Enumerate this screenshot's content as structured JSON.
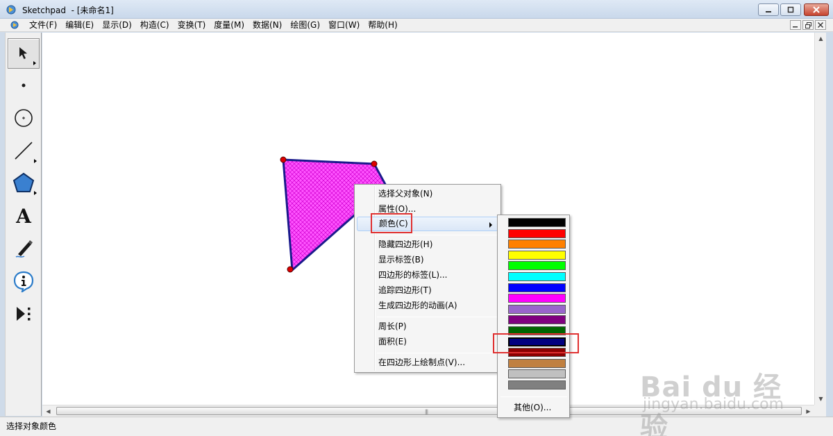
{
  "window": {
    "app_name": "Sketchpad",
    "document": "- [未命名1]"
  },
  "menubar": {
    "items": [
      "文件(F)",
      "编辑(E)",
      "显示(D)",
      "构造(C)",
      "变换(T)",
      "度量(M)",
      "数据(N)",
      "绘图(G)",
      "窗口(W)",
      "帮助(H)"
    ]
  },
  "toolbox": {
    "tools": [
      "arrow-select-tool",
      "point-tool",
      "compass-tool",
      "straightedge-tool",
      "polygon-tool",
      "text-tool",
      "marker-tool",
      "information-tool",
      "custom-tool"
    ],
    "text_tool_glyph": "A"
  },
  "context_menu": {
    "items": [
      "选择父对象(N)",
      "属性(O)...",
      "颜色(C)",
      "隐藏四边形(H)",
      "显示标签(B)",
      "四边形的标签(L)...",
      "追踪四边形(T)",
      "生成四边形的动画(A)",
      "周长(P)",
      "面积(E)",
      "在四边形上绘制点(V)..."
    ],
    "highlighted_index": 2
  },
  "color_menu": {
    "swatches": [
      "#000000",
      "#ff0000",
      "#ff8000",
      "#ffff00",
      "#00ff00",
      "#00ffff",
      "#0000ff",
      "#ff00ff",
      "#9966cc",
      "#800080",
      "#006400",
      "#000080",
      "#8b0000",
      "#c08040",
      "#c0c0c0",
      "#808080"
    ],
    "selected_index": 11,
    "other_label": "其他(O)..."
  },
  "shape": {
    "fill": "#ff33ff",
    "stroke": "#1a1a8c",
    "vertex_color": "#dd0000"
  },
  "statusbar": {
    "text": "选择对象颜色"
  },
  "watermark": {
    "brand": "Bai du 经验",
    "url": "jingyan.baidu.com"
  }
}
